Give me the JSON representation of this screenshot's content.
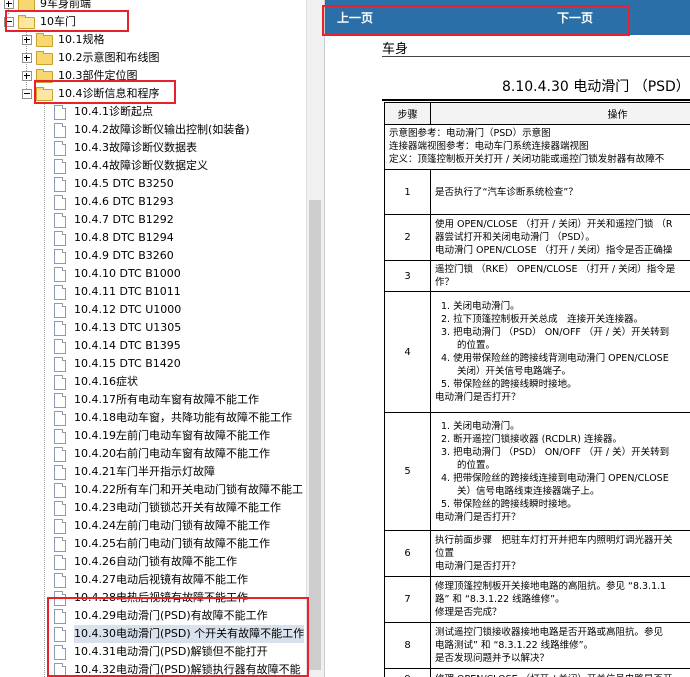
{
  "tree": {
    "items": [
      {
        "label": "9车身前端",
        "kind": "folder"
      },
      {
        "label": "10车门",
        "kind": "folder-open"
      },
      {
        "label": "10.1规格",
        "kind": "folder"
      },
      {
        "label": "10.2示意图和布线图",
        "kind": "folder"
      },
      {
        "label": "10.3部件定位图",
        "kind": "folder"
      },
      {
        "label": "10.4诊断信息和程序",
        "kind": "folder-open"
      },
      {
        "label": "10.4.1诊断起点",
        "kind": "doc"
      },
      {
        "label": "10.4.2故障诊断仪输出控制(如装备)",
        "kind": "doc"
      },
      {
        "label": "10.4.3故障诊断仪数据表",
        "kind": "doc"
      },
      {
        "label": "10.4.4故障诊断仪数据定义",
        "kind": "doc"
      },
      {
        "label": "10.4.5 DTC B3250",
        "kind": "doc"
      },
      {
        "label": "10.4.6 DTC B1293",
        "kind": "doc"
      },
      {
        "label": "10.4.7 DTC B1292",
        "kind": "doc"
      },
      {
        "label": "10.4.8 DTC B1294",
        "kind": "doc"
      },
      {
        "label": "10.4.9 DTC B3260",
        "kind": "doc"
      },
      {
        "label": "10.4.10 DTC B1000",
        "kind": "doc"
      },
      {
        "label": "10.4.11 DTC B1011",
        "kind": "doc"
      },
      {
        "label": "10.4.12 DTC U1000",
        "kind": "doc"
      },
      {
        "label": "10.4.13 DTC U1305",
        "kind": "doc"
      },
      {
        "label": "10.4.14 DTC B1395",
        "kind": "doc"
      },
      {
        "label": "10.4.15 DTC B1420",
        "kind": "doc"
      },
      {
        "label": "10.4.16症状",
        "kind": "doc"
      },
      {
        "label": "10.4.17所有电动车窗有故障不能工作",
        "kind": "doc"
      },
      {
        "label": "10.4.18电动车窗，共降功能有故障不能工作",
        "kind": "doc"
      },
      {
        "label": "10.4.19左前门电动车窗有故障不能工作",
        "kind": "doc"
      },
      {
        "label": "10.4.20右前门电动车窗有故障不能工作",
        "kind": "doc"
      },
      {
        "label": "10.4.21车门半开指示灯故障",
        "kind": "doc"
      },
      {
        "label": "10.4.22所有车门和开关电动门锁有故障不能工",
        "kind": "doc"
      },
      {
        "label": "10.4.23电动门锁锁芯开关有故障不能工作",
        "kind": "doc"
      },
      {
        "label": "10.4.24左前门电动门锁有故障不能工作",
        "kind": "doc"
      },
      {
        "label": "10.4.25右前门电动门锁有故障不能工作",
        "kind": "doc"
      },
      {
        "label": "10.4.26自动门锁有故障不能工作",
        "kind": "doc"
      },
      {
        "label": "10.4.27电动后视镜有故障不能工作",
        "kind": "doc"
      },
      {
        "label": "10.4.28电热后视镜有故障不能工作",
        "kind": "doc"
      },
      {
        "label": "10.4.29电动滑门(PSD)有故障不能工作",
        "kind": "doc"
      },
      {
        "label": "10.4.30电动滑门(PSD) 个开关有故障不能工作",
        "kind": "doc",
        "selected": true
      },
      {
        "label": "10.4.31电动滑门(PSD)解锁但不能打开",
        "kind": "doc"
      },
      {
        "label": "10.4.32电动滑门(PSD)解锁执行器有故障不能",
        "kind": "doc"
      }
    ]
  },
  "doc": {
    "prev": "上一页",
    "next": "下一页",
    "section": "车身",
    "title": "8.10.4.30 电动滑门 （PSD）",
    "col_step": "步骤",
    "col_action": "操作",
    "intro": [
      "示意图参考：电动滑门（PSD）示意图",
      "连接器端视图参考：电动车门系统连接器端视图",
      "定义：顶篷控制板开关打开 / 关闭功能或遥控门锁发射器有故障不"
    ],
    "rows": [
      {
        "step": "1",
        "lines": [
          "是否执行了“汽车诊断系统检查”？"
        ]
      },
      {
        "step": "2",
        "lines": [
          "使用 OPEN/CLOSE （打开 / 关闭）开关和遥控门锁 （R",
          "器尝试打开和关闭电动滑门 （PSD）。",
          "电动滑门 OPEN/CLOSE （打开 / 关闭）指令是否正确操"
        ]
      },
      {
        "step": "3",
        "lines": [
          "遥控门锁 （RKE） OPEN/CLOSE （打开 / 关闭）指令是",
          "作？"
        ]
      },
      {
        "step": "4",
        "list": [
          "关闭电动滑门。",
          "拉下顶篷控制板开关总成　连接开关连接器。",
          "把电动滑门 （PSD） ON/OFF （开 / 关）开关转到",
          "的位置。",
          "使用带保险丝的跨接线背测电动滑门 OPEN/CLOSE",
          "关闭）开关信号电路端子。",
          "带保险丝的跨接线瞬时接地。"
        ],
        "nums": [
          "1.",
          "2.",
          "3.",
          "",
          "4.",
          "",
          "5."
        ],
        "tail": "电动滑门是否打开？"
      },
      {
        "step": "5",
        "list": [
          "关闭电动滑门。",
          "断开遥控门锁接收器 (RCDLR) 连接器。",
          "把电动滑门 （PSD） ON/OFF （开 / 关）开关转到",
          "的位置。",
          "把带保险丝的跨接线连接到电动滑门 OPEN/CLOSE",
          "关）信号电路线束连接器端子上。",
          "带保险丝的跨接线瞬时接地。"
        ],
        "nums": [
          "1.",
          "2.",
          "3.",
          "",
          "4.",
          "",
          "5."
        ],
        "tail": "电动滑门是否打开？"
      },
      {
        "step": "6",
        "lines": [
          "执行前面步骤　把驻车灯打开并把车内照明灯调光器开关",
          "位置",
          "电动滑门是否打开？"
        ]
      },
      {
        "step": "7",
        "lines": [
          "修理顶篷控制板开关接地电路的高阻抗。参见 “8.3.1.1",
          "路” 和 “8.3.1.22 线路维修”。",
          "修理是否完成？"
        ]
      },
      {
        "step": "8",
        "lines": [
          "测试遥控门锁接收器接地电路是否开路或高阻抗。参见",
          "电路测试” 和 “8.3.1.22 线路维修”。",
          "是否发现问题并予以解决？"
        ]
      },
      {
        "step": "9",
        "lines": [
          "修理 OPEN/CLOSE （打开 / 关闭）开关信号电路是否开"
        ]
      }
    ]
  }
}
